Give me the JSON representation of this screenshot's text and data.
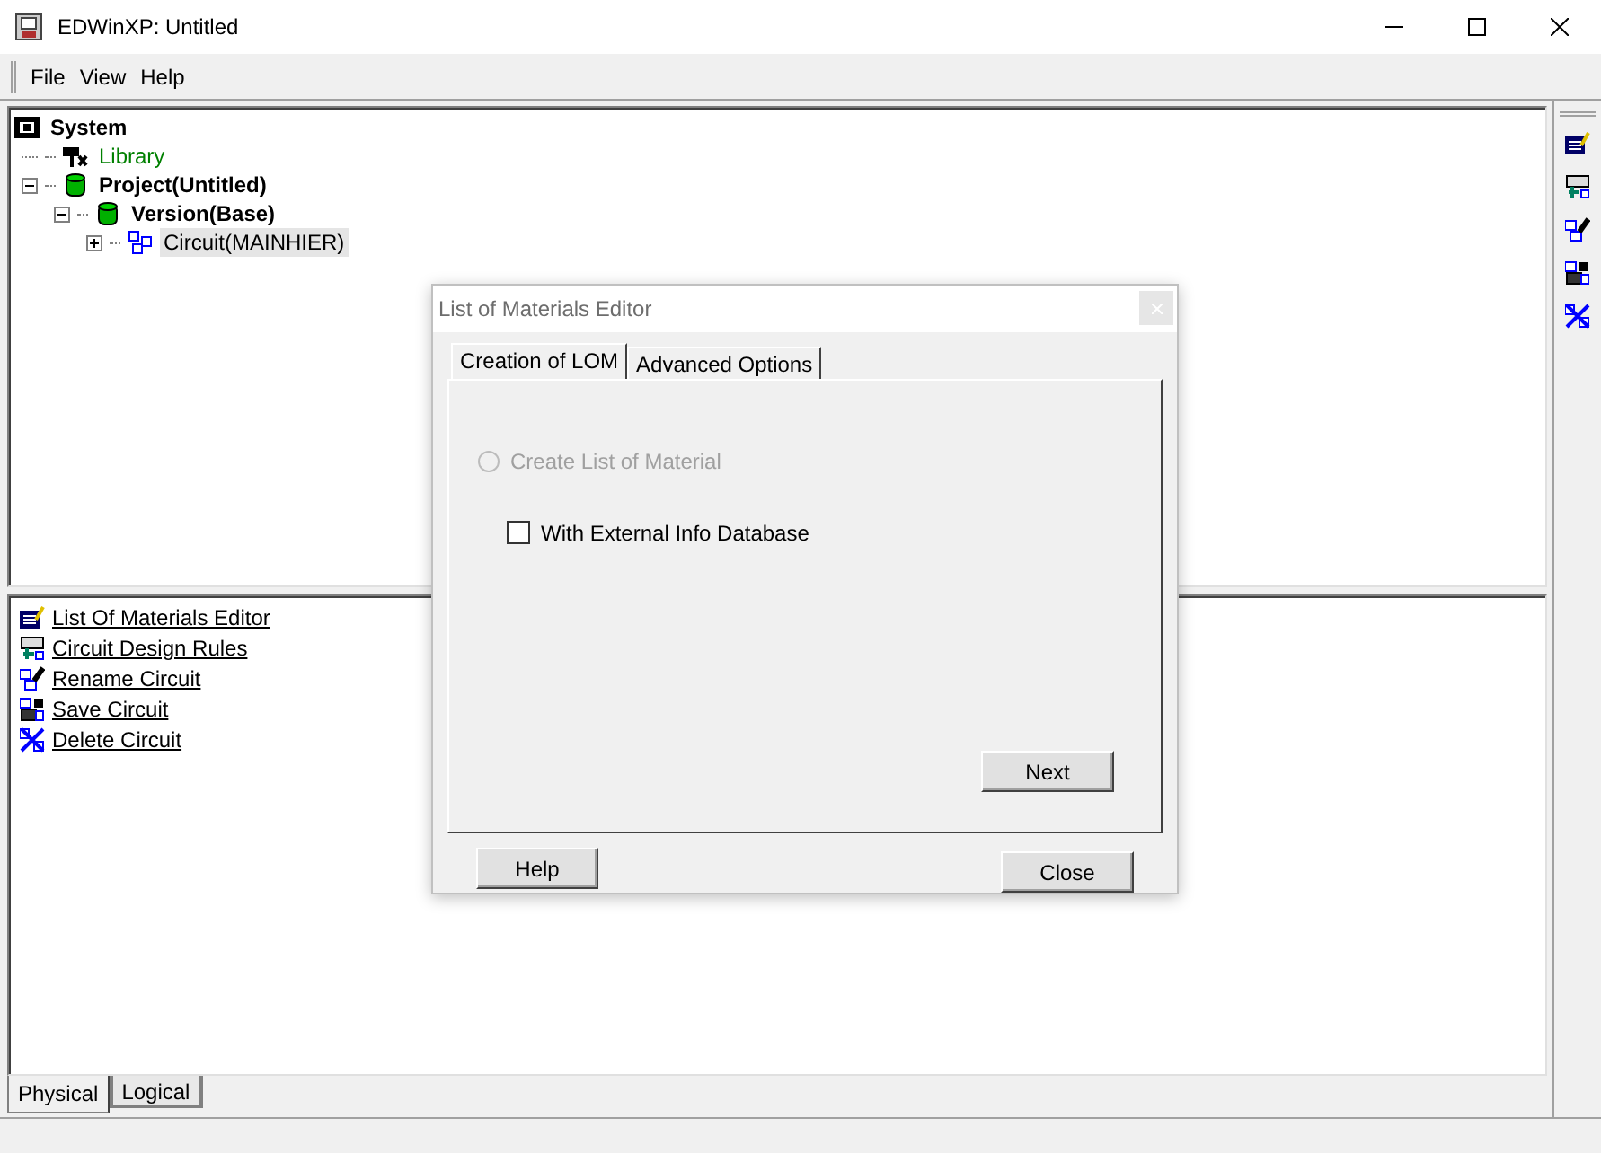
{
  "window": {
    "title": "EDWinXP: Untitled"
  },
  "menu": [
    "File",
    "View",
    "Help"
  ],
  "tree": [
    {
      "label": "System",
      "kind": "root",
      "selected": false,
      "children": [
        {
          "label": "Library",
          "kind": "library",
          "selected": false
        },
        {
          "label": "Project(Untitled)",
          "kind": "project",
          "selected": false,
          "expanded": true,
          "children": [
            {
              "label": "Version(Base)",
              "kind": "version",
              "selected": false,
              "expanded": true,
              "children": [
                {
                  "label": "Circuit(MAINHIER)",
                  "kind": "circuit",
                  "selected": true,
                  "expanded": false
                }
              ]
            }
          ]
        }
      ]
    }
  ],
  "actions": [
    {
      "label": "List Of Materials Editor",
      "kind": "lom"
    },
    {
      "label": "Circuit Design Rules",
      "kind": "rules"
    },
    {
      "label": "Rename Circuit",
      "kind": "rename"
    },
    {
      "label": "Save Circuit",
      "kind": "save"
    },
    {
      "label": "Delete Circuit",
      "kind": "delete"
    }
  ],
  "toolbar": [
    {
      "kind": "lom"
    },
    {
      "kind": "rules"
    },
    {
      "kind": "rename"
    },
    {
      "kind": "save"
    },
    {
      "kind": "delete"
    }
  ],
  "bottom_tabs": [
    {
      "label": "Physical",
      "selected": true
    },
    {
      "label": "Logical",
      "selected": false
    }
  ],
  "dialog": {
    "title": "List of Materials Editor",
    "tabs": [
      {
        "label": "Creation of LOM",
        "selected": true
      },
      {
        "label": "Advanced Options",
        "selected": false
      }
    ],
    "radio": {
      "label": "Create List of Material",
      "checked": false,
      "disabled": true
    },
    "checkbox": {
      "label": "With External Info Database",
      "checked": false
    },
    "next_button": "Next",
    "help_button": "Help",
    "close_button": "Close"
  }
}
